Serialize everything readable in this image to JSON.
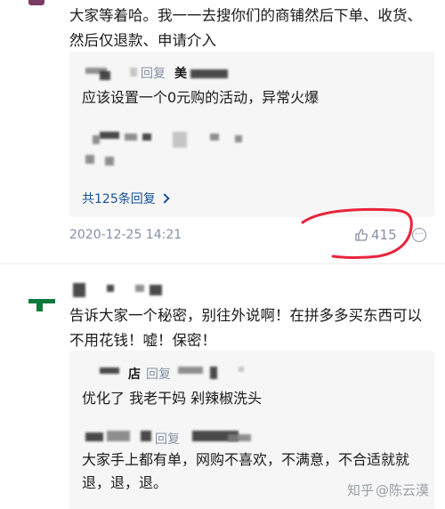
{
  "comment1": {
    "text": "大家等着哈。我一一去搜你们的商铺然后下单、收货、然后仅退款、申请介入",
    "reply": {
      "reply_word": "回复",
      "reply_to": "美",
      "text": "应该设置一个0元购的活动，异常火爆"
    },
    "more_replies_label": "共125条回复",
    "date": "2020-12-25 14:21",
    "likes": "415",
    "more_icon": "···"
  },
  "comment2": {
    "text": "告诉大家一个秘密，别往外说啊！在拼多多买东西可以不用花钱！嘘！保密！",
    "replies": [
      {
        "name_fragment": "店",
        "reply_word": "回复",
        "text": "优化了 我老干妈 剁辣椒洗头"
      },
      {
        "reply_word": "回复",
        "text": "大家手上都有单，网购不喜欢，不满意，不合适就就退，退，退。"
      }
    ]
  },
  "watermark": {
    "site": "知乎",
    "author": "@陈云漠"
  },
  "colors": {
    "link": "#175199",
    "meta": "#8590a6",
    "annotation": "#e8243a",
    "avatar2": "#0b7a3a"
  }
}
